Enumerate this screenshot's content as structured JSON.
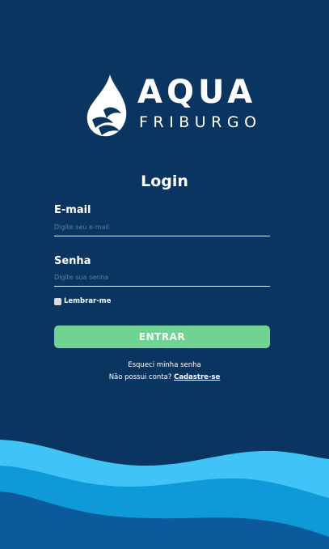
{
  "brand": {
    "name": "AQUA",
    "subtitle": "FRIBURGO"
  },
  "login": {
    "title": "Login",
    "email_label": "E-mail",
    "email_placeholder": "Digite seu e-mail",
    "password_label": "Senha",
    "password_placeholder": "Digite sua senha",
    "remember_label": "Lembrar-me",
    "remember_checked": false,
    "submit_label": "ENTRAR",
    "forgot_label": "Esqueci minha senha",
    "no_account_text": "Não possui conta?",
    "signup_label": "Cadastre-se"
  },
  "colors": {
    "background": "#0a3560",
    "button": "#6fd493",
    "wave_light": "#40c4f8",
    "wave_mid": "#0f99d8",
    "wave_deep": "#0a5a9c"
  }
}
